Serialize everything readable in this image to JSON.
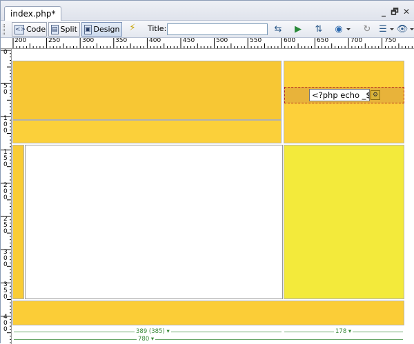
{
  "tab": {
    "label": "index.php*"
  },
  "window_controls": {
    "minimize": "_",
    "restore": "🗗",
    "close": "✕"
  },
  "toolbar": {
    "code_label": "Code",
    "split_label": "Split",
    "design_label": "Design",
    "title_label": "Title:",
    "title_value": ""
  },
  "ruler": {
    "h_labels": [
      "200",
      "250",
      "300",
      "350",
      "400",
      "450",
      "500",
      "550",
      "600",
      "650",
      "700",
      "750"
    ],
    "v_labels": [
      "0",
      "50",
      "100",
      "150",
      "200",
      "250",
      "300",
      "350",
      "400"
    ]
  },
  "php_snippet": {
    "text": "<?php echo _$"
  },
  "measurements": {
    "left_col": "389 (385)",
    "right_col": "178",
    "total": "780"
  },
  "colors": {
    "header_gold": "#f7c734",
    "nav_gold": "#fbd03a",
    "sidebar_gold": "#fdd03a",
    "content_yellow": "#f3ea3b",
    "footer_gold": "#fbcd37"
  }
}
